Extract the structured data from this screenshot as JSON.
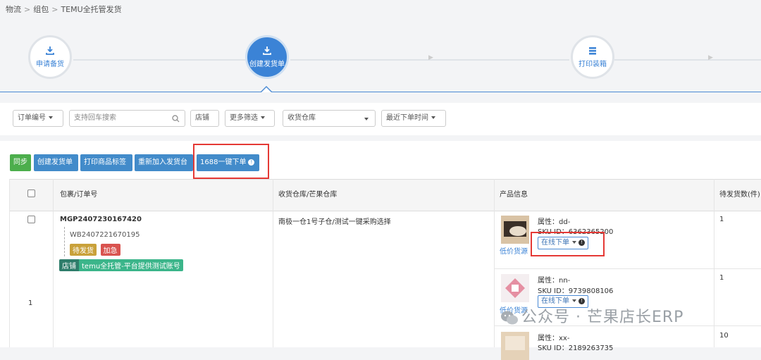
{
  "breadcrumb": {
    "items": [
      "物流",
      "组包",
      "TEMU全托管发货"
    ],
    "sep": ">"
  },
  "steps": [
    {
      "label": "申请备货",
      "icon": "download-icon"
    },
    {
      "label": "创建发货单",
      "icon": "download-icon",
      "active": true
    },
    {
      "label": "打印装箱",
      "icon": "print-list-icon"
    }
  ],
  "filters": {
    "order_no": "订单编号",
    "search_placeholder": "支持回车搜索",
    "store": "店铺",
    "more": "更多筛选",
    "warehouse": "收货仓库",
    "recent": "最近下单时间"
  },
  "toolbar": {
    "sync": "同步",
    "create": "创建发货单",
    "print_labels": "打印商品标签",
    "re_add": "重新加入发货台",
    "one_click": "1688一键下单"
  },
  "table": {
    "headers": [
      "包裹/订单号",
      "收货仓库/芒果仓库",
      "产品信息",
      "待发货数(件)"
    ],
    "row": {
      "index": "1",
      "package_no": "MGP2407230167420",
      "order_no": "WB2407221670195",
      "status_tag": "待发货",
      "urgent_tag": "加急",
      "store_label": "店铺",
      "store_name": "temu全托管-平台提供测试账号",
      "warehouse": "南极一仓1号子仓/测试一键采购选择",
      "products": [
        {
          "attr": "属性：dd-",
          "sku": "SKU ID：6362365200",
          "online": "在线下单",
          "low": "低价货源",
          "qty": "1"
        },
        {
          "attr": "属性：nn-",
          "sku": "SKU ID：9739808106",
          "online": "在线下单",
          "low": "低价货源",
          "qty": "1"
        },
        {
          "attr": "属性：xx-",
          "sku": "SKU ID：2189263735",
          "qty": "10"
        }
      ]
    }
  },
  "watermark": "公众号 · 芒果店长ERP"
}
